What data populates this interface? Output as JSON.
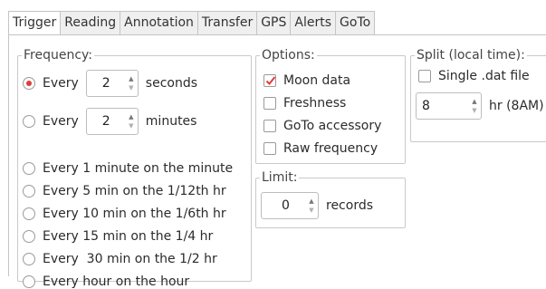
{
  "tabs": [
    {
      "label": "Trigger",
      "active": true
    },
    {
      "label": "Reading"
    },
    {
      "label": "Annotation"
    },
    {
      "label": "Transfer"
    },
    {
      "label": "GPS"
    },
    {
      "label": "Alerts"
    },
    {
      "label": "GoTo"
    }
  ],
  "frequency": {
    "legend": "Frequency:",
    "every_seconds": {
      "prefix": "Every",
      "value": "2",
      "unit": "seconds",
      "selected": true
    },
    "every_minutes": {
      "prefix": "Every",
      "value": "2",
      "unit": "minutes",
      "selected": false
    },
    "options": [
      "Every 1 minute on the minute",
      "Every 5 min on the 1/12th hr",
      "Every 10 min on the 1/6th hr",
      "Every 15 min on the 1/4 hr",
      "Every  30 min on the 1/2 hr",
      "Every hour on the hour"
    ]
  },
  "options": {
    "legend": "Options:",
    "items": [
      {
        "label": "Moon data",
        "checked": true
      },
      {
        "label": "Freshness",
        "checked": false
      },
      {
        "label": "GoTo accessory",
        "checked": false
      },
      {
        "label": "Raw frequency",
        "checked": false
      }
    ]
  },
  "limit": {
    "legend": "Limit:",
    "value": "0",
    "unit": "records"
  },
  "split": {
    "legend": "Split (local time):",
    "single_dat": {
      "label": "Single .dat file",
      "checked": false
    },
    "hour_value": "8",
    "hour_unit": "hr (8AM)"
  },
  "colors": {
    "accent": "#e23a3a",
    "border": "#c9c9c9"
  }
}
